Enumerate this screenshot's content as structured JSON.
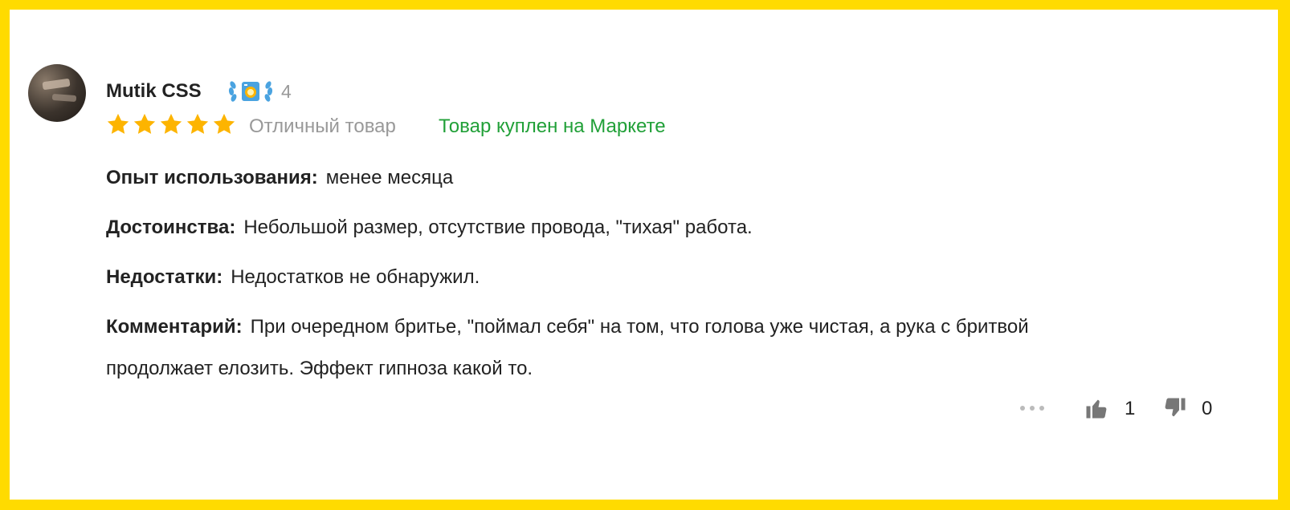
{
  "review": {
    "author": "Mutik CSS",
    "level": "4",
    "rating": 5,
    "rating_text": "Отличный товар",
    "purchase_badge": "Товар куплен на Маркете",
    "experience_label": "Опыт использования:",
    "experience_value": "менее месяца",
    "pros_label": "Достоинства:",
    "pros_value": "Небольшой размер, отсутствие провода, \"тихая\" работа.",
    "cons_label": "Недостатки:",
    "cons_value": "Недостатков не обнаружил.",
    "comment_label": "Комментарий:",
    "comment_line1": "При очередном бритье, \"поймал себя\" на том, что голова уже чистая, а рука с бритвой",
    "comment_line2": "продолжает елозить. Эффект гипноза какой то."
  },
  "footer": {
    "likes": "1",
    "dislikes": "0"
  },
  "colors": {
    "frame": "#ffdb00",
    "star": "#fdb400",
    "badge_green": "#21a038",
    "laurel": "#4aa3e0"
  },
  "icons": [
    "avatar",
    "laurel-badge-icon",
    "star-icon",
    "more-dots-icon",
    "thumb-up-icon",
    "thumb-down-icon"
  ]
}
